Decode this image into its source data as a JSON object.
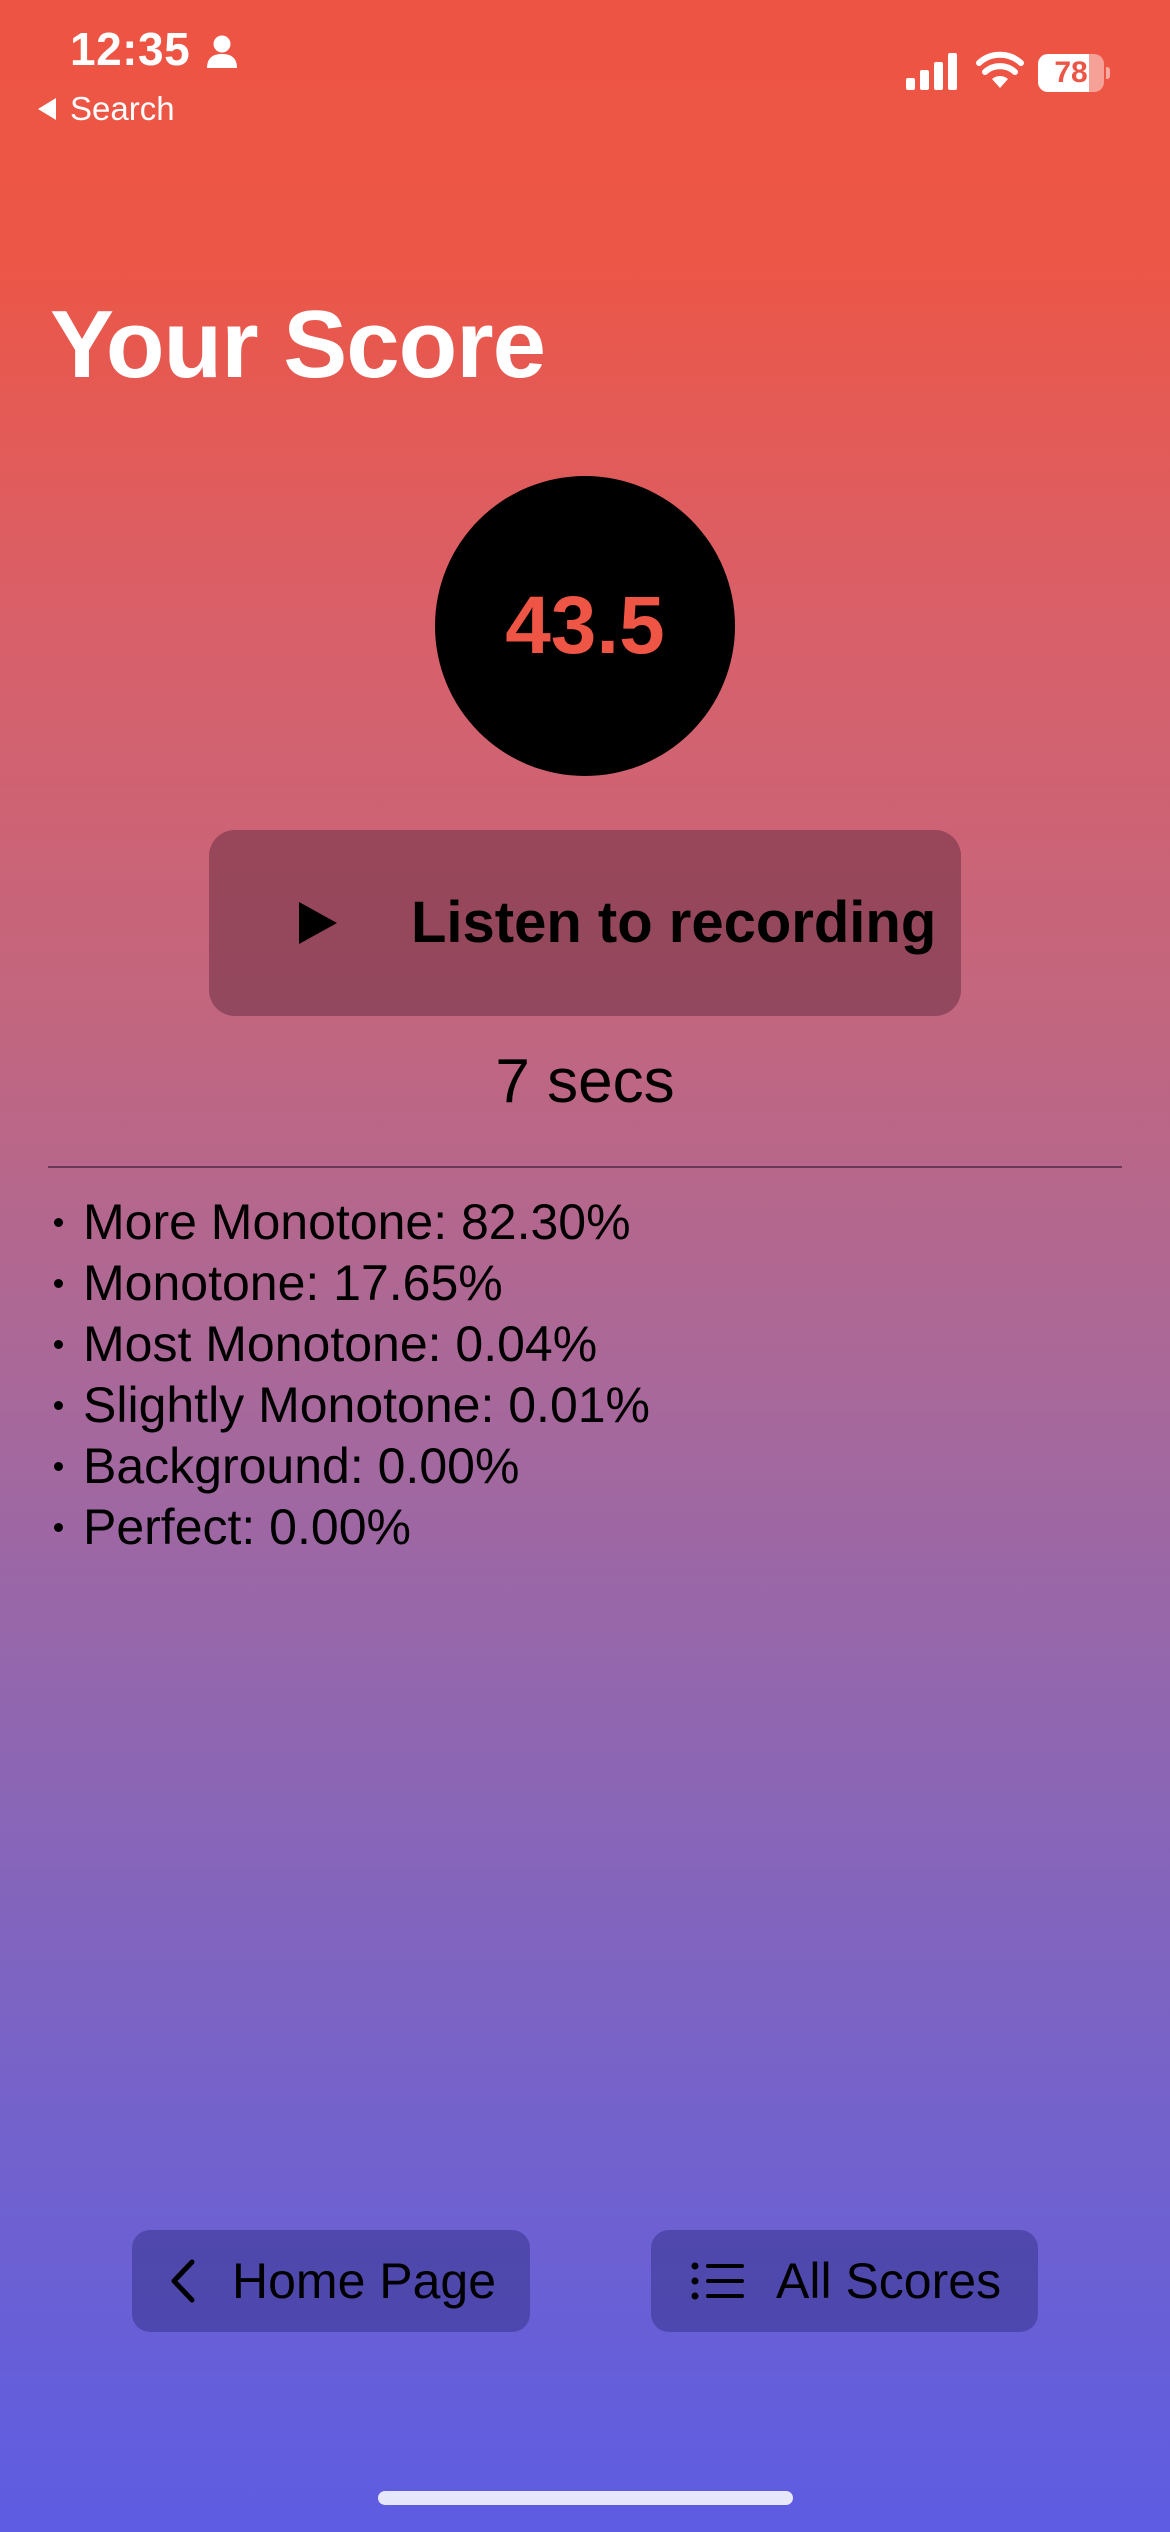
{
  "status_bar": {
    "time": "12:35",
    "back_label": "Search",
    "battery_level": "78",
    "battery_fraction": 0.78
  },
  "title": "Your Score",
  "score": "43.5",
  "listen_button": {
    "label": "Listen to recording"
  },
  "duration": "7 secs",
  "breakdown": [
    "More Monotone: 82.30%",
    "Monotone: 17.65%",
    "Most Monotone: 0.04%",
    "Slightly Monotone: 0.01%",
    "Background: 0.00%",
    "Perfect: 0.00%"
  ],
  "bottom_nav": {
    "home_label": "Home Page",
    "scores_label": "All Scores"
  },
  "colors": {
    "gradient_top": "#ee5443",
    "gradient_bottom": "#5d5ce2",
    "score_text": "#ef5545"
  }
}
